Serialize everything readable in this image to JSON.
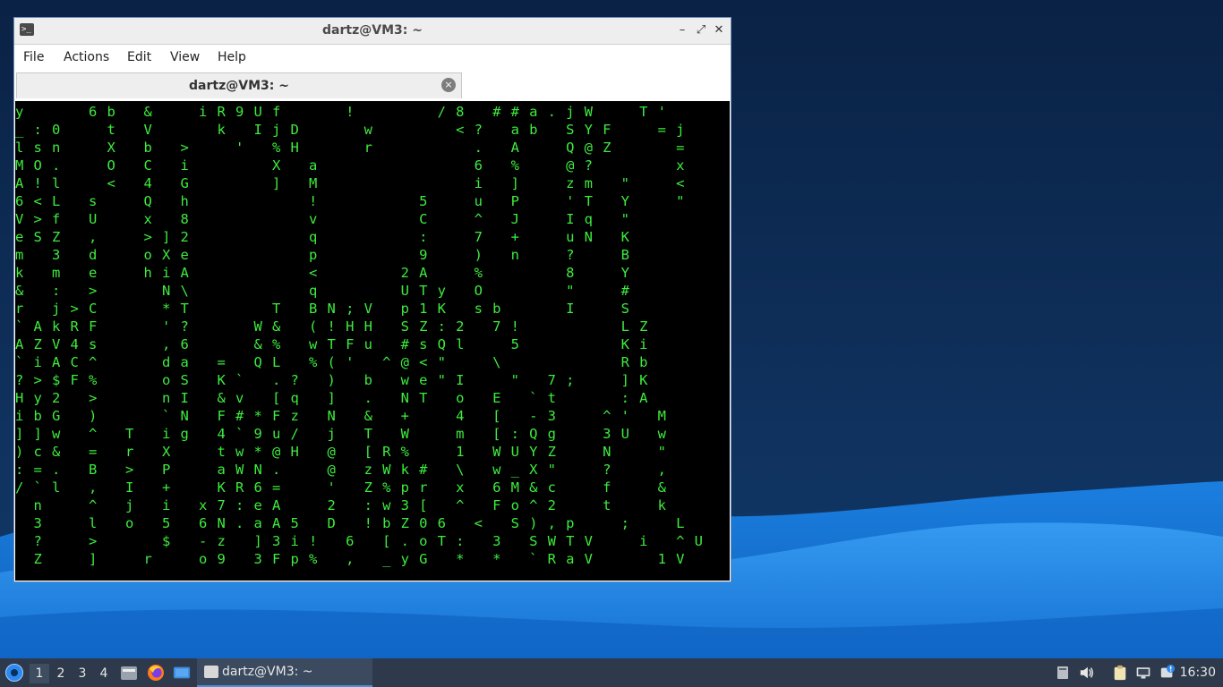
{
  "window": {
    "title": "dartz@VM3: ~",
    "minimize_glyph": "–",
    "maximize_glyph": "⤢",
    "close_glyph": "✕",
    "terminal_icon_text": ">_"
  },
  "menu": {
    "file": "File",
    "actions": "Actions",
    "edit": "Edit",
    "view": "View",
    "help": "Help"
  },
  "tab": {
    "label": "dartz@VM3: ~",
    "close_glyph": "×"
  },
  "terminal": {
    "matrix_text": "y       6 b   &     i R 9 U f       !         / 8   # # a . j W     T '\n_ : 0     t   V       k   I j D       w         < ?   a b   S Y F     = j\nl s n     X   b   >     '   % H       r           .   A     Q @ Z       =\nM O .     O   C   i         X   a                 6   %     @ ?         x\nA ! l     <   4   G         ]   M                 i   ]     z m   \"     <\n6 < L   s     Q   h             !           5     u   P     ' T   Y     \"\nV > f   U     x   8             v           C     ^   J     I q   \"\ne S Z   ,     > ] 2             q           :     7   +     u N   K\nm   3   d     o X e             p           9     )   n     ?     B\nk   m   e     h i A             <         2 A     %         8     Y\n&   :   >       N \\             q         U T y   O         \"     #\nr   j > C       * T         T   B N ; V   p 1 K   s b       I     S\n` A k R F       ' ?       W &   ( ! H H   S Z : 2   7 !           L Z\nA Z V 4 s       , 6       & %   w T F u   # s Q l     5           K i\n` i A C ^       d a   =   Q L   % ( '   ^ @ < \"     \\             R b\n? > $ F %       o S   K `   . ?   )   b   w e \" I     \"   7 ;     ] K\nH y 2   >       n I   & v   [ q   ]   .   N T   o   E   ` t       : A\ni b G   )       ` N   F # * F z   N   &   +     4   [   - 3     ^ '   M\n] ] w   ^   T   i g   4 ` 9 u /   j   T   W     m   [ : Q g     3 U   w\n) c &   =   r   X     t w * @ H   @   [ R %     1   W U Y Z     N     \"\n: = .   B   >   P     a W N .     @   z W k #   \\   w _ X \"     ?     ,\n/ ` l   ,   I   +     K R 6 =     '   Z % p r   x   6 M & c     f     &\n  n     ^   j   i   x 7 : e A     2   : w 3 [   ^   F o ^ 2     t     k\n  3     l   o   5   6 N . a A 5   D   ! b Z 0 6   <   S ) , p     ;     L\n  ?     >       $   - z   ] 3 i !   6   [ . o T :   3   S W T V     i   ^ U\n  Z     ]     r     o 9   3 F p %   ,   _ y G   *   *   ` R a V       1 V"
  },
  "taskbar": {
    "workspaces": [
      "1",
      "2",
      "3",
      "4"
    ],
    "task_label": "dartz@VM3: ~",
    "clock": "16:30"
  },
  "colors": {
    "desktop_top": "#0b2548",
    "desktop_wave": "#1e8be6",
    "matrix_green": "#3dec3d",
    "taskbar_bg": "#2e3a4b"
  }
}
